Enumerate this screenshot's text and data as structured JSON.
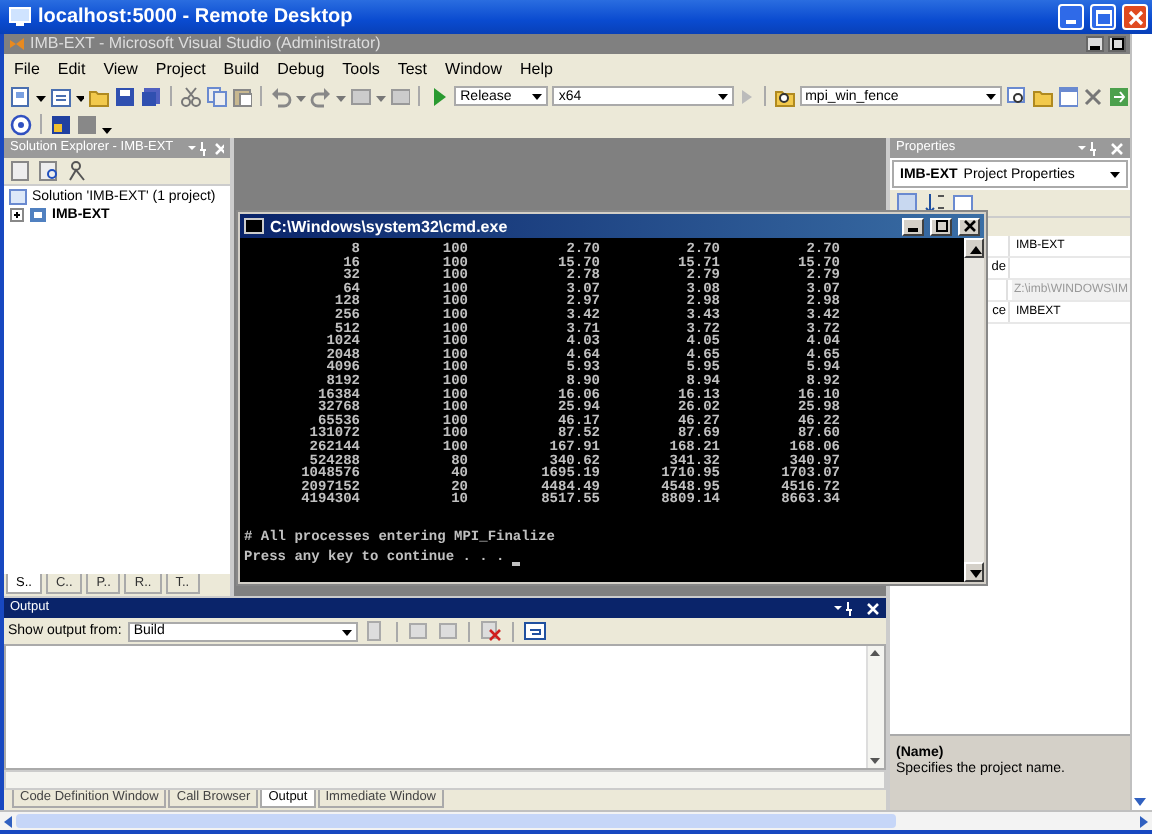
{
  "remote_desktop": {
    "title": "localhost:5000 - Remote Desktop"
  },
  "window": {
    "title": "IMB-EXT - Microsoft Visual Studio (Administrator)"
  },
  "menu": [
    "File",
    "Edit",
    "View",
    "Project",
    "Build",
    "Debug",
    "Tools",
    "Test",
    "Window",
    "Help"
  ],
  "toolbar": {
    "configuration": "Release",
    "platform": "x64",
    "find": "mpi_win_fence"
  },
  "solution_explorer": {
    "title": "Solution Explorer - IMB-EXT",
    "tree": [
      {
        "label": "Solution 'IMB-EXT' (1 project)",
        "children": [
          {
            "label": "IMB-EXT",
            "expanded": false
          }
        ]
      }
    ],
    "tabs": [
      {
        "label": "S..",
        "selected": true
      },
      {
        "label": "C..",
        "selected": false
      },
      {
        "label": "P..",
        "selected": false
      },
      {
        "label": "R..",
        "selected": false
      },
      {
        "label": "T..",
        "selected": false
      }
    ]
  },
  "console": {
    "title": "C:\\Windows\\system32\\cmd.exe",
    "rows": [
      [
        "8",
        "100",
        "2.70",
        "2.70",
        "2.70"
      ],
      [
        "16",
        "100",
        "15.70",
        "15.71",
        "15.70"
      ],
      [
        "32",
        "100",
        "2.78",
        "2.79",
        "2.79"
      ],
      [
        "64",
        "100",
        "3.07",
        "3.08",
        "3.07"
      ],
      [
        "128",
        "100",
        "2.97",
        "2.98",
        "2.98"
      ],
      [
        "256",
        "100",
        "3.42",
        "3.43",
        "3.42"
      ],
      [
        "512",
        "100",
        "3.71",
        "3.72",
        "3.72"
      ],
      [
        "1024",
        "100",
        "4.03",
        "4.05",
        "4.04"
      ],
      [
        "2048",
        "100",
        "4.64",
        "4.65",
        "4.65"
      ],
      [
        "4096",
        "100",
        "5.93",
        "5.95",
        "5.94"
      ],
      [
        "8192",
        "100",
        "8.90",
        "8.94",
        "8.92"
      ],
      [
        "16384",
        "100",
        "16.06",
        "16.13",
        "16.10"
      ],
      [
        "32768",
        "100",
        "25.94",
        "26.02",
        "25.98"
      ],
      [
        "65536",
        "100",
        "46.17",
        "46.27",
        "46.22"
      ],
      [
        "131072",
        "100",
        "87.52",
        "87.69",
        "87.60"
      ],
      [
        "262144",
        "100",
        "167.91",
        "168.21",
        "168.06"
      ],
      [
        "524288",
        "80",
        "340.62",
        "341.32",
        "340.97"
      ],
      [
        "1048576",
        "40",
        "1695.19",
        "1710.95",
        "1703.07"
      ],
      [
        "2097152",
        "20",
        "4484.49",
        "4548.95",
        "4516.72"
      ],
      [
        "4194304",
        "10",
        "8517.55",
        "8809.14",
        "8663.34"
      ]
    ],
    "message": "# All processes entering MPI_Finalize",
    "prompt": "Press any key to continue . . ."
  },
  "properties": {
    "title": "Properties",
    "object": "IMB-EXT",
    "object_type": "Project Properties",
    "rows": [
      {
        "value": "IMB-EXT",
        "disabled": false
      },
      {
        "label": "de",
        "disabled": false
      },
      {
        "value": "Z:\\imb\\WINDOWS\\IM",
        "disabled": true
      },
      {
        "label": "ce",
        "value": "IMBEXT",
        "disabled": false
      }
    ],
    "description": {
      "name": "(Name)",
      "text": "Specifies the project name."
    }
  },
  "output": {
    "title": "Output",
    "label": "Show output from:",
    "source": "Build",
    "tabs": [
      {
        "label": "Code Definition Window",
        "selected": false
      },
      {
        "label": "Call Browser",
        "selected": false
      },
      {
        "label": "Output",
        "selected": true
      },
      {
        "label": "Immediate Window",
        "selected": false
      }
    ]
  }
}
